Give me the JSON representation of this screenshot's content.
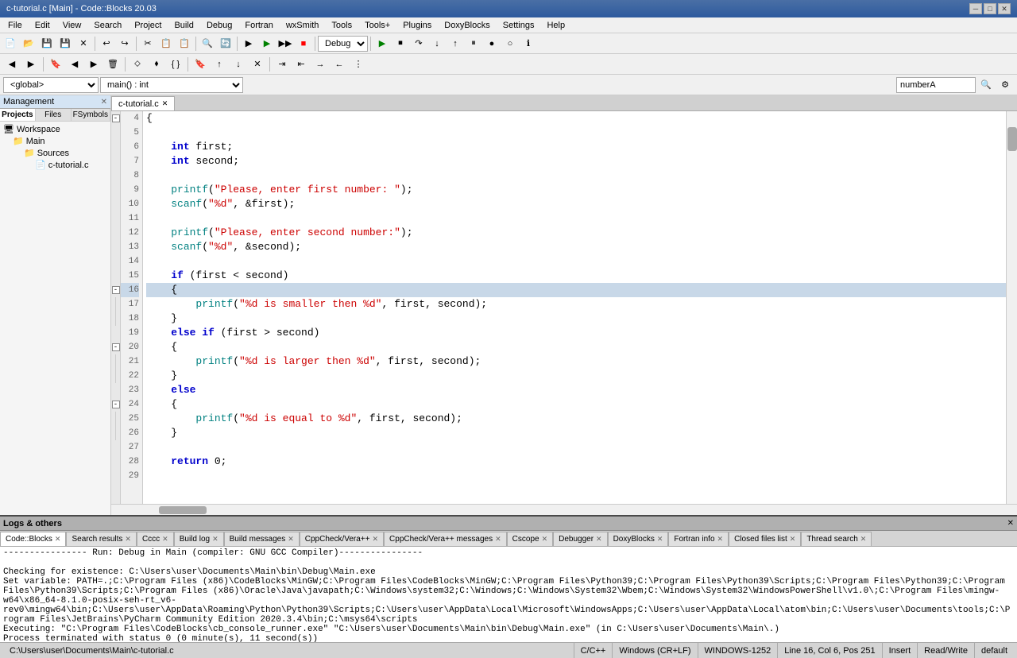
{
  "titleBar": {
    "title": "c-tutorial.c [Main] - Code::Blocks 20.03",
    "controls": [
      "minimize",
      "maximize",
      "close"
    ]
  },
  "menuBar": {
    "items": [
      "File",
      "Edit",
      "View",
      "Search",
      "Project",
      "Build",
      "Debug",
      "Fortran",
      "wxSmith",
      "Tools",
      "Tools+",
      "Plugins",
      "DoxyBlocks",
      "Settings",
      "Help"
    ]
  },
  "toolbar1": {
    "debugDropdown": "Debug"
  },
  "globalDropdown": "<global>",
  "funcDropdown": "main() : int",
  "searchInput": "numberA",
  "leftPanel": {
    "title": "Management",
    "tabs": [
      "Projects",
      "Files",
      "FSymbols"
    ],
    "tree": {
      "workspace": "Workspace",
      "main": "Main",
      "sources": "Sources",
      "file": "c-tutorial.c"
    }
  },
  "editorTab": {
    "name": "c-tutorial.c",
    "active": true
  },
  "codeLines": [
    {
      "num": 4,
      "content": "{",
      "indent": 0
    },
    {
      "num": 5,
      "content": "",
      "indent": 0
    },
    {
      "num": 6,
      "content": "    int first;",
      "indent": 1
    },
    {
      "num": 7,
      "content": "    int second;",
      "indent": 1
    },
    {
      "num": 8,
      "content": "",
      "indent": 0
    },
    {
      "num": 9,
      "content": "    printf(\"Please, enter first number: \");",
      "indent": 1
    },
    {
      "num": 10,
      "content": "    scanf(\"%d\", &first);",
      "indent": 1
    },
    {
      "num": 11,
      "content": "",
      "indent": 0
    },
    {
      "num": 12,
      "content": "    printf(\"Please, enter second number:\");",
      "indent": 1
    },
    {
      "num": 13,
      "content": "    scanf(\"%d\", &second);",
      "indent": 1
    },
    {
      "num": 14,
      "content": "",
      "indent": 0
    },
    {
      "num": 15,
      "content": "    if (first < second)",
      "indent": 1
    },
    {
      "num": 16,
      "content": "    {",
      "indent": 1
    },
    {
      "num": 17,
      "content": "        printf(\"%d is smaller then %d\", first, second);",
      "indent": 2
    },
    {
      "num": 18,
      "content": "    }",
      "indent": 1
    },
    {
      "num": 19,
      "content": "    else if (first > second)",
      "indent": 1
    },
    {
      "num": 20,
      "content": "    {",
      "indent": 1
    },
    {
      "num": 21,
      "content": "        printf(\"%d is larger then %d\", first, second);",
      "indent": 2
    },
    {
      "num": 22,
      "content": "    }",
      "indent": 1
    },
    {
      "num": 23,
      "content": "    else",
      "indent": 1
    },
    {
      "num": 24,
      "content": "    {",
      "indent": 1
    },
    {
      "num": 25,
      "content": "        printf(\"%d is equal to %d\", first, second);",
      "indent": 2
    },
    {
      "num": 26,
      "content": "    }",
      "indent": 1
    },
    {
      "num": 27,
      "content": "",
      "indent": 0
    },
    {
      "num": 28,
      "content": "    return 0;",
      "indent": 1
    },
    {
      "num": 29,
      "content": "",
      "indent": 0
    }
  ],
  "bottomPanel": {
    "title": "Logs & others",
    "tabs": [
      "Code::Blocks",
      "Search results",
      "Cccc",
      "Build log",
      "Build messages",
      "CppCheck/Vera++",
      "CppCheck/Vera++ messages",
      "Cscope",
      "Debugger",
      "DoxyBlocks",
      "Fortran info",
      "Closed files list",
      "Thread search"
    ],
    "activeTab": "Code::Blocks",
    "logContent": [
      "---------------- Run: Debug in Main (compiler: GNU GCC Compiler)----------------",
      "",
      "Checking for existence: C:\\Users\\user\\Documents\\Main\\bin\\Debug\\Main.exe",
      "Set variable: PATH=.;C:\\Program Files (x86)\\CodeBlocks\\MinGW;C:\\Program Files\\CodeBlocks\\MinGW;C:\\Program Files\\Python39;C:\\Program Files\\Python39\\Scripts;C:\\Program Files\\Python39;C:\\Program Files\\Python39\\Scripts;C:\\Program Files (x86)\\Oracle\\Java\\javapath;C:\\Windows\\system32;C:\\Windows;C:\\Windows\\System32\\Wbem;C:\\Windows\\System32\\WindowsPowerShell\\v1.0\\;C:\\Program Files\\mingw-w64\\x86_64-8.1.0-posix-seh-rt_v6-rev0\\mingw64\\bin;C:\\Users\\user\\AppData\\Roaming\\Python\\Python39\\Scripts;C:\\Users\\user\\AppData\\Local\\Microsoft\\WindowsApps;C:\\Users\\user\\AppData\\Local\\atom\\bin;C:\\Users\\user\\Documents\\tools;C:\\Program Files\\JetBrains\\PyCharm Community Edition 2020.3.4\\bin;C:\\msys64\\scripts",
      "Executing: \"C:\\Program Files\\CodeBlocks\\cb_console_runner.exe\" \"C:\\Users\\user\\Documents\\Main\\bin\\Debug\\Main.exe\"  (in C:\\Users\\user\\Documents\\Main\\.)",
      "Process terminated with status 0 (0 minute(s), 11 second(s))"
    ]
  },
  "statusBar": {
    "filePath": "C:\\Users\\user\\Documents\\Main\\c-tutorial.c",
    "language": "C/C++",
    "lineEnding": "Windows (CR+LF)",
    "encoding": "WINDOWS-1252",
    "position": "Line 16, Col 6, Pos 251",
    "mode": "Insert",
    "readWrite": "Read/Write",
    "style": "default"
  }
}
